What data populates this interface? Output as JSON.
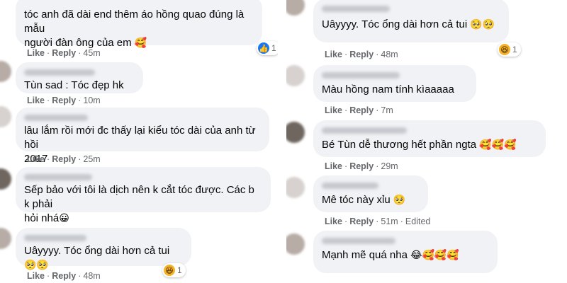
{
  "actions": {
    "like": "Like",
    "reply": "Reply",
    "sep": "·",
    "edited": "Edited"
  },
  "left": [
    {
      "text": "tóc anh đã dài end thêm áo hồng quao đúng là mẫu\nngười đàn ông của em",
      "emoji": "🥰",
      "time": "45m",
      "reaction_icon": "like-icon",
      "reaction_count": "1"
    },
    {
      "text": "Tùn sad : Tóc đẹp hk",
      "emoji": "",
      "time": "10m"
    },
    {
      "text": "lâu lắm rồi mới đc thấy lại kiểu tóc dài của anh từ hồi\n2017",
      "emoji": "",
      "time": "25m"
    },
    {
      "text": "Sếp bảo với tôi là dịch nên k cắt tóc được. Các b k phải\nhỏi nhá",
      "emoji": "😀",
      "time": ""
    },
    {
      "text": "Uâyyyy. Tóc ổng dài hơn cả tui",
      "emoji": "🥺🥺",
      "time": "48m",
      "reaction_icon": "haha-icon",
      "reaction_count": "1"
    }
  ],
  "right": [
    {
      "text": "Uâyyyy. Tóc ổng dài hơn cả tui",
      "emoji": "🥺🥺",
      "time": "48m",
      "reaction_icon": "haha-icon",
      "reaction_count": "1"
    },
    {
      "text": "Màu hồng nam tính kìaaaaa",
      "emoji": "",
      "time": "7m"
    },
    {
      "text": "Bé Tùn dễ thương hết phần ngta",
      "emoji": "🥰🥰🥰",
      "time": "29m"
    },
    {
      "text": "Mê tóc này xỉu",
      "emoji": "🥺",
      "time": "51m"
    },
    {
      "text": "Mạnh mẽ quá nha",
      "emoji": "😂🥰🥰🥰",
      "time": ""
    }
  ],
  "colors": {
    "bubble": "#f0f2f5",
    "meta": "#65676b",
    "text": "#050505",
    "like_blue": "#1877f2"
  }
}
